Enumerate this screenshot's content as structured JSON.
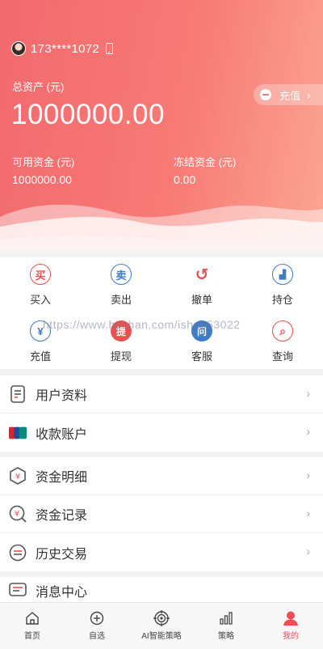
{
  "header": {
    "phone": "173****1072",
    "total_label": "总资产 (元)",
    "total_value": "1000000.00",
    "recharge_label": "充值",
    "available_label": "可用资金 (元)",
    "available_value": "1000000.00",
    "frozen_label": "冻结资金 (元)",
    "frozen_value": "0.00"
  },
  "actions": [
    {
      "label": "买入",
      "glyph": "买",
      "color": "#e8514f"
    },
    {
      "label": "卖出",
      "glyph": "卖",
      "color": "#3f7cc4"
    },
    {
      "label": "撤单",
      "glyph": "↺",
      "color": "#e8514f"
    },
    {
      "label": "持仓",
      "glyph": "▟",
      "color": "#3f7cc4"
    },
    {
      "label": "充值",
      "glyph": "¥",
      "color": "#3f7cc4"
    },
    {
      "label": "提现",
      "glyph": "提",
      "color": "#e8514f"
    },
    {
      "label": "客服",
      "glyph": "问",
      "color": "#3f7cc4"
    },
    {
      "label": "查询",
      "glyph": "⌕",
      "color": "#e8514f"
    }
  ],
  "watermark": "https://www.huzhan.com/ishop53022",
  "menu_groups": [
    [
      {
        "label": "用户资料",
        "icon": "profile-icon"
      },
      {
        "label": "收款账户",
        "icon": "unionpay-card-icon"
      }
    ],
    [
      {
        "label": "资金明细",
        "icon": "fund-detail-icon"
      },
      {
        "label": "资金记录",
        "icon": "fund-record-icon"
      },
      {
        "label": "历史交易",
        "icon": "history-trade-icon"
      }
    ],
    [
      {
        "label": "消息中心",
        "icon": "message-icon"
      }
    ]
  ],
  "tabbar": [
    {
      "label": "首页",
      "icon": "home-icon",
      "active": false
    },
    {
      "label": "自选",
      "icon": "add-favorite-icon",
      "active": false
    },
    {
      "label": "AI智能策略",
      "icon": "ai-strategy-icon",
      "active": false
    },
    {
      "label": "策略",
      "icon": "strategy-chart-icon",
      "active": false
    },
    {
      "label": "我的",
      "icon": "my-profile-icon",
      "active": true
    }
  ]
}
